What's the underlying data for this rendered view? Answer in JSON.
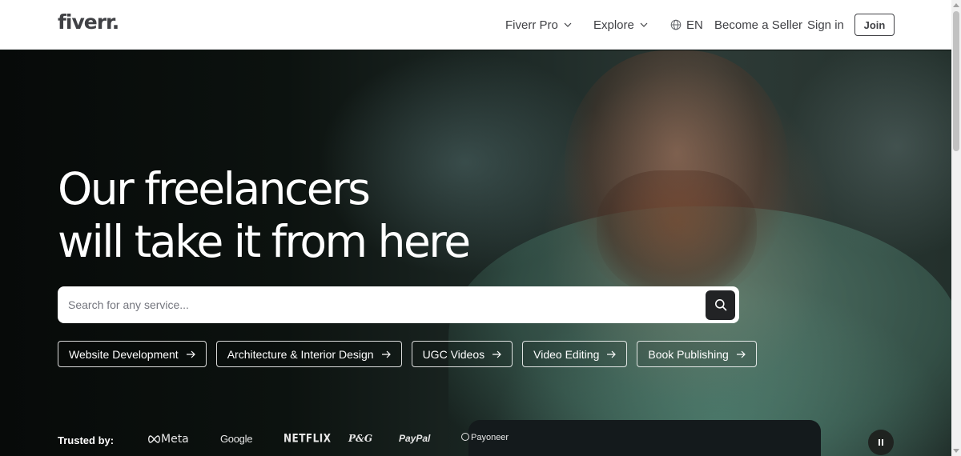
{
  "header": {
    "logo": "fiverr",
    "logo_dot": ".",
    "nav": {
      "fiverr_pro": "Fiverr Pro",
      "explore": "Explore",
      "language": "EN",
      "become_seller": "Become a Seller",
      "sign_in": "Sign in",
      "join": "Join"
    }
  },
  "hero": {
    "headline_line1": "Our freelancers",
    "headline_line2": "will take it from here",
    "search": {
      "placeholder": "Search for any service...",
      "value": ""
    },
    "categories": [
      {
        "label": "Website Development"
      },
      {
        "label": "Architecture & Interior Design"
      },
      {
        "label": "UGC Videos"
      },
      {
        "label": "Video Editing"
      },
      {
        "label": "Book Publishing"
      }
    ],
    "trusted_by": {
      "label": "Trusted by:",
      "brands": [
        "Meta",
        "Google",
        "NETFLIX",
        "P&G",
        "PayPal",
        "Payoneer"
      ]
    }
  },
  "colors": {
    "header_bg": "#ffffff",
    "text_dark": "#404145",
    "search_button": "#222325",
    "hero_text": "#ffffff"
  },
  "icons": {
    "nav_chevron": "chevron-down-icon",
    "language": "globe-icon",
    "search": "search-icon",
    "pill_arrow": "arrow-right-icon",
    "video_control": "pause-icon",
    "meta_logo": "infinity-icon"
  }
}
